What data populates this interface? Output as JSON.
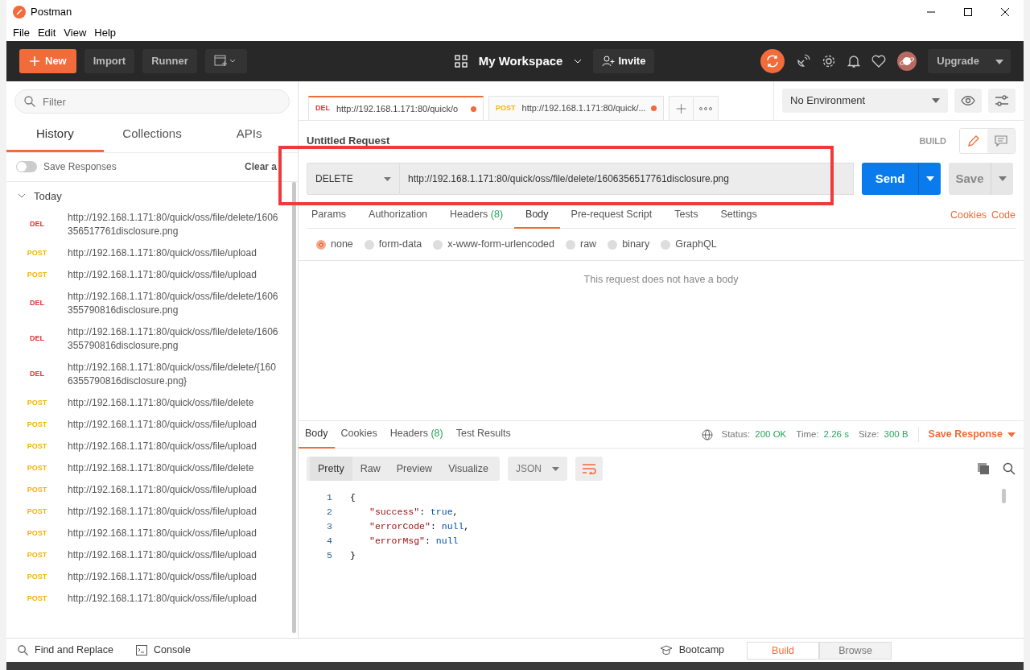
{
  "window": {
    "title": "Postman"
  },
  "menu": [
    "File",
    "Edit",
    "View",
    "Help"
  ],
  "toolbar": {
    "new": "New",
    "import": "Import",
    "runner": "Runner",
    "workspace": "My Workspace",
    "invite": "Invite",
    "upgrade": "Upgrade"
  },
  "sidebar": {
    "filter_placeholder": "Filter",
    "tabs": [
      {
        "label": "History",
        "selected": true
      },
      {
        "label": "Collections",
        "selected": false
      },
      {
        "label": "APIs",
        "selected": false
      }
    ],
    "save_responses": {
      "label": "Save Responses",
      "on": false
    },
    "clear": "Clear a",
    "group": {
      "label": "Today",
      "expanded": true,
      "items": [
        {
          "method": "DEL",
          "kind": "delete",
          "url": "http://192.168.1.171:80/quick/oss/file/delete/1606356517761disclosure.png"
        },
        {
          "method": "POST",
          "kind": "post",
          "url": "http://192.168.1.171:80/quick/oss/file/upload"
        },
        {
          "method": "POST",
          "kind": "post",
          "url": "http://192.168.1.171:80/quick/oss/file/upload"
        },
        {
          "method": "DEL",
          "kind": "delete",
          "url": "http://192.168.1.171:80/quick/oss/file/delete/1606355790816disclosure.png"
        },
        {
          "method": "DEL",
          "kind": "delete",
          "url": "http://192.168.1.171:80/quick/oss/file/delete/1606355790816disclosure.png"
        },
        {
          "method": "DEL",
          "kind": "delete",
          "url": "http://192.168.1.171:80/quick/oss/file/delete/{1606355790816disclosure.png}"
        },
        {
          "method": "POST",
          "kind": "post",
          "url": "http://192.168.1.171:80/quick/oss/file/delete"
        },
        {
          "method": "POST",
          "kind": "post",
          "url": "http://192.168.1.171:80/quick/oss/file/upload"
        },
        {
          "method": "POST",
          "kind": "post",
          "url": "http://192.168.1.171:80/quick/oss/file/upload"
        },
        {
          "method": "POST",
          "kind": "post",
          "url": "http://192.168.1.171:80/quick/oss/file/delete"
        },
        {
          "method": "POST",
          "kind": "post",
          "url": "http://192.168.1.171:80/quick/oss/file/upload"
        },
        {
          "method": "POST",
          "kind": "post",
          "url": "http://192.168.1.171:80/quick/oss/file/upload"
        },
        {
          "method": "POST",
          "kind": "post",
          "url": "http://192.168.1.171:80/quick/oss/file/upload"
        },
        {
          "method": "POST",
          "kind": "post",
          "url": "http://192.168.1.171:80/quick/oss/file/upload"
        },
        {
          "method": "POST",
          "kind": "post",
          "url": "http://192.168.1.171:80/quick/oss/file/upload"
        },
        {
          "method": "POST",
          "kind": "post",
          "url": "http://192.168.1.171:80/quick/oss/file/upload"
        }
      ]
    }
  },
  "request_tabs": [
    {
      "method": "DEL",
      "kind": "delete",
      "url": "http://192.168.1.171:80/quick/o",
      "selected": true,
      "unsaved": true
    },
    {
      "method": "POST",
      "kind": "post",
      "url": "http://192.168.1.171:80/quick/...",
      "selected": false,
      "unsaved": true
    }
  ],
  "environment": "No Environment",
  "request": {
    "name": "Untitled Request",
    "mode": "BUILD",
    "method": "DELETE",
    "url": "http://192.168.1.171:80/quick/oss/file/delete/1606356517761disclosure.png",
    "send": "Send",
    "save": "Save",
    "tabs": [
      {
        "label": "Params",
        "selected": false
      },
      {
        "label": "Authorization",
        "selected": false
      },
      {
        "label": "Headers",
        "count": "(8)",
        "selected": false
      },
      {
        "label": "Body",
        "selected": true
      },
      {
        "label": "Pre-request Script",
        "selected": false
      },
      {
        "label": "Tests",
        "selected": false
      },
      {
        "label": "Settings",
        "selected": false
      }
    ],
    "links": [
      "Cookies",
      "Code"
    ],
    "body_types": [
      {
        "label": "none",
        "selected": true
      },
      {
        "label": "form-data",
        "selected": false
      },
      {
        "label": "x-www-form-urlencoded",
        "selected": false
      },
      {
        "label": "raw",
        "selected": false
      },
      {
        "label": "binary",
        "selected": false
      },
      {
        "label": "GraphQL",
        "selected": false
      }
    ],
    "empty_message": "This request does not have a body"
  },
  "response": {
    "tabs": [
      {
        "label": "Body",
        "selected": true
      },
      {
        "label": "Cookies",
        "selected": false
      },
      {
        "label": "Headers",
        "count": "(8)",
        "selected": false
      },
      {
        "label": "Test Results",
        "selected": false
      }
    ],
    "stats": [
      {
        "label": "Status:",
        "value": "200 OK"
      },
      {
        "label": "Time:",
        "value": "2.26 s"
      },
      {
        "label": "Size:",
        "value": "300 B"
      }
    ],
    "save": "Save Response",
    "views": [
      {
        "label": "Pretty",
        "selected": true
      },
      {
        "label": "Raw",
        "selected": false
      },
      {
        "label": "Preview",
        "selected": false
      },
      {
        "label": "Visualize",
        "selected": false
      }
    ],
    "format": "JSON",
    "lines": [
      {
        "number": "1",
        "tokens": [
          {
            "kind": "punct",
            "text": "{"
          }
        ]
      },
      {
        "number": "2",
        "tokens": [
          {
            "kind": "key",
            "text": "\"success\""
          },
          {
            "kind": "punct",
            "text": ": "
          },
          {
            "kind": "bool",
            "text": "true"
          },
          {
            "kind": "punct",
            "text": ","
          }
        ],
        "indent": true
      },
      {
        "number": "3",
        "tokens": [
          {
            "kind": "key",
            "text": "\"errorCode\""
          },
          {
            "kind": "punct",
            "text": ": "
          },
          {
            "kind": "null",
            "text": "null"
          },
          {
            "kind": "punct",
            "text": ","
          }
        ],
        "indent": true
      },
      {
        "number": "4",
        "tokens": [
          {
            "kind": "key",
            "text": "\"errorMsg\""
          },
          {
            "kind": "punct",
            "text": ": "
          },
          {
            "kind": "null",
            "text": "null"
          }
        ],
        "indent": true
      },
      {
        "number": "5",
        "tokens": [
          {
            "kind": "punct",
            "text": "}"
          }
        ]
      }
    ]
  },
  "footer": {
    "find": "Find and Replace",
    "console": "Console",
    "bootcamp": "Bootcamp",
    "modes": [
      {
        "label": "Build",
        "selected": true
      },
      {
        "label": "Browse",
        "selected": false
      }
    ]
  }
}
